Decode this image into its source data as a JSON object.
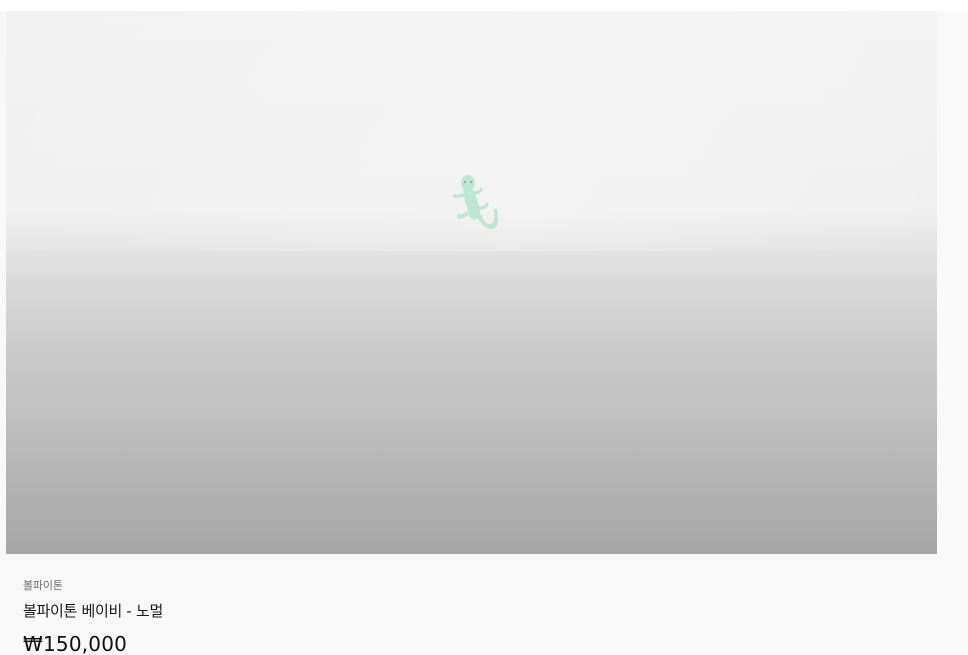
{
  "product": {
    "category": "볼파이톤",
    "title": "볼파이톤 베이비 - 노멀",
    "price": "₩150,000"
  },
  "image": {
    "icon": "gecko-icon",
    "icon_color": "#bfe6d4"
  }
}
